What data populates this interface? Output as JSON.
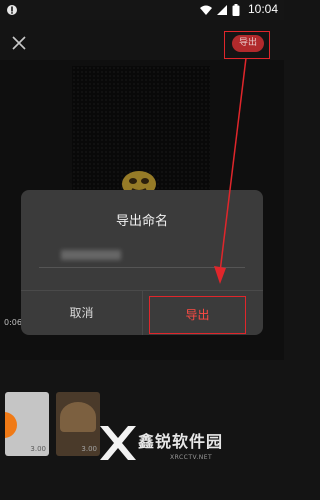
{
  "status_bar": {
    "time": "10:04",
    "icons": [
      "android-robot-icon",
      "wifi-icon",
      "cellular-signal-icon",
      "battery-icon"
    ]
  },
  "toolbar": {
    "close_icon": "close-icon",
    "export_label": "导出"
  },
  "timeline": {
    "time_label": "0:06"
  },
  "dialog": {
    "title": "导出命名",
    "input_value": "",
    "cancel_label": "取消",
    "confirm_label": "导出"
  },
  "thumbnails": [
    {
      "duration": "3.00"
    },
    {
      "duration": "3.00"
    }
  ],
  "watermark": {
    "brand": "鑫锐软件园",
    "url": "XRCCTV.NET"
  },
  "colors": {
    "highlight": "#e0262b",
    "export_button": "#b12a2c",
    "dialog_bg": "#3b3b3b"
  }
}
